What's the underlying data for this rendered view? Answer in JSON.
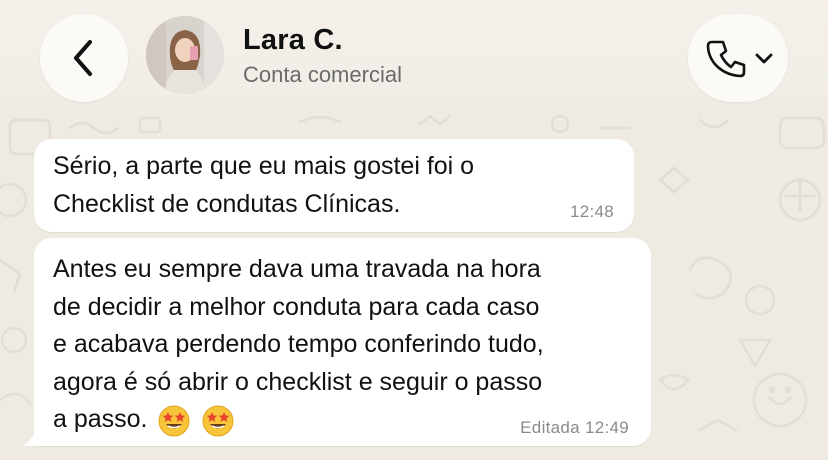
{
  "header": {
    "contact_name": "Lara C.",
    "contact_subtitle": "Conta comercial",
    "back_icon": "chevron-left-icon",
    "call_icon": "phone-icon",
    "call_menu_icon": "chevron-down-icon"
  },
  "messages": [
    {
      "text": "Sério, a parte que eu mais gostei foi o\nChecklist de condutas Clínicas.",
      "time": "12:48"
    },
    {
      "text": "Antes eu sempre dava uma travada na hora\nde decidir a melhor conduta para cada caso\ne acabava perdendo tempo conferindo tudo,\nagora é só abrir o checklist e seguir o passo\na passo.",
      "time": "Editada 12:49",
      "emojis": [
        "star-struck-emoji",
        "star-struck-emoji"
      ]
    }
  ],
  "colors": {
    "chat_background": "#efeae2",
    "bubble": "#ffffff",
    "header_button": "#fbfaf7",
    "timestamp": "#8a8a8a"
  }
}
